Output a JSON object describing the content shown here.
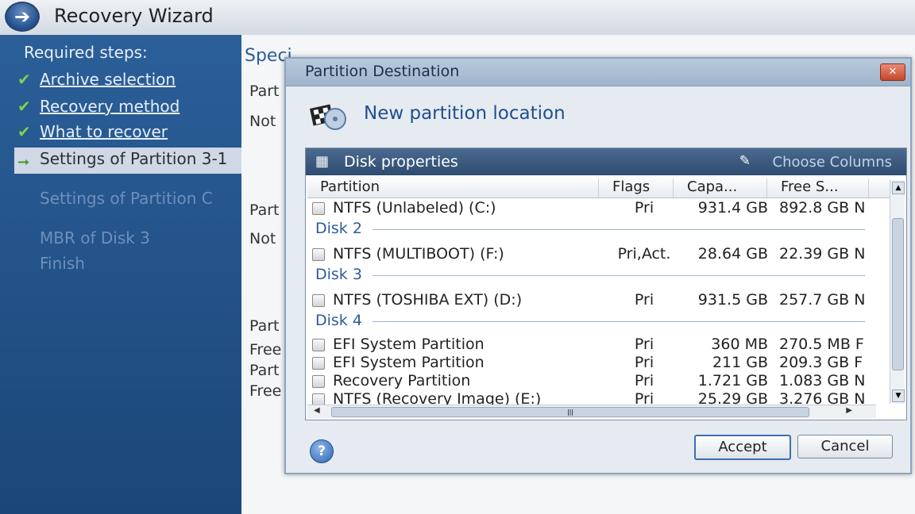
{
  "window": {
    "title": "Recovery Wizard"
  },
  "sidebar": {
    "heading": "Required steps:",
    "steps": [
      {
        "label": "Archive selection",
        "state": "done"
      },
      {
        "label": "Recovery method",
        "state": "done"
      },
      {
        "label": "What to recover",
        "state": "done"
      },
      {
        "label": "Settings of Partition 3-1",
        "state": "current"
      },
      {
        "label": "Settings of Partition C",
        "state": "pending"
      },
      {
        "label": "MBR of Disk 3",
        "state": "pending"
      },
      {
        "label": "Finish",
        "state": "pending"
      }
    ]
  },
  "main": {
    "heading": "Speci",
    "labels": [
      "Part",
      "Not",
      "Part",
      "Not",
      "Part",
      "Free",
      "Part",
      "Free"
    ]
  },
  "dialog": {
    "title": "Partition Destination",
    "header": "New partition location",
    "panel_title": "Disk properties",
    "choose_columns": "Choose Columns",
    "columns": [
      "Partition",
      "Flags",
      "Capa...",
      "Free S..."
    ],
    "rows": [
      {
        "type": "row",
        "name": "NTFS (Unlabeled) (C:)",
        "flags": "Pri",
        "capacity": "931.4 GB",
        "free": "892.8 GB N"
      },
      {
        "type": "group",
        "name": "Disk 2"
      },
      {
        "type": "row",
        "name": "NTFS (MULTIBOOT) (F:)",
        "flags": "Pri,Act.",
        "capacity": "28.64 GB",
        "free": "22.39 GB N"
      },
      {
        "type": "group",
        "name": "Disk 3"
      },
      {
        "type": "row",
        "name": "NTFS (TOSHIBA EXT) (D:)",
        "flags": "Pri",
        "capacity": "931.5 GB",
        "free": "257.7 GB N"
      },
      {
        "type": "group",
        "name": "Disk 4"
      },
      {
        "type": "row",
        "name": "EFI System Partition",
        "flags": "Pri",
        "capacity": "360 MB",
        "free": "270.5 MB F"
      },
      {
        "type": "row",
        "name": "EFI System Partition",
        "flags": "Pri",
        "capacity": "211 GB",
        "free": "209.3 GB F"
      },
      {
        "type": "row",
        "name": "Recovery Partition",
        "flags": "Pri",
        "capacity": "1.721 GB",
        "free": "1.083 GB N"
      },
      {
        "type": "row",
        "name": "NTFS (Recovery Image) (E:)",
        "flags": "Pri",
        "capacity": "25.29 GB",
        "free": "3.276 GB N"
      }
    ],
    "accept_label": "Accept",
    "cancel_label": "Cancel",
    "help_label": "?"
  },
  "icons": {
    "back": "back-arrow-icon",
    "check": "checkmark-icon",
    "current": "current-step-arrow-icon",
    "disk": "disk-properties-icon",
    "columns": "choose-columns-icon",
    "header": "partition-location-icon"
  }
}
